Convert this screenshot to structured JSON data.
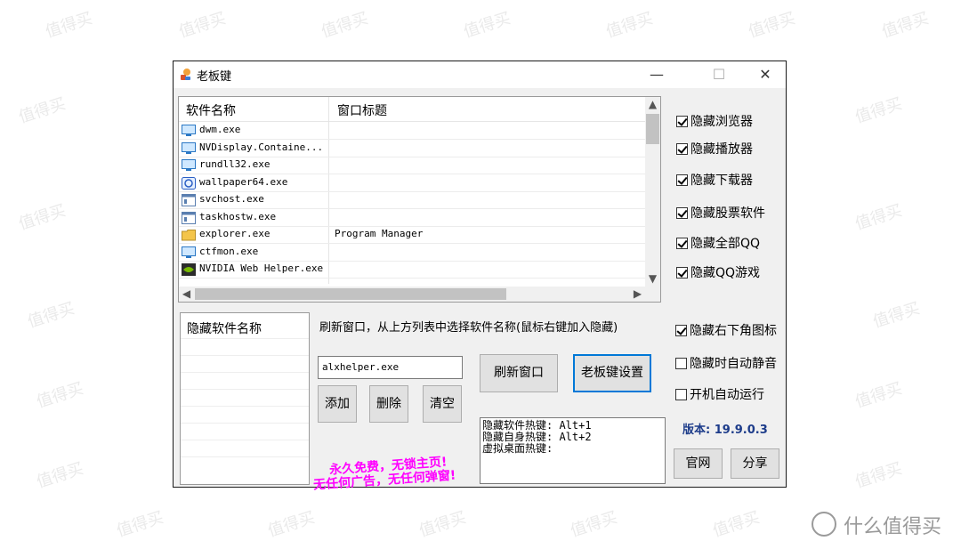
{
  "window": {
    "title": "老板键",
    "min_glyph": "—",
    "max_glyph": "☐",
    "close_glyph": "✕"
  },
  "process_list": {
    "columns": [
      "软件名称",
      "窗口标题"
    ],
    "rows": [
      {
        "name": "dwm.exe",
        "title": "",
        "icon": "monitor-icon"
      },
      {
        "name": "NVDisplay.Containe...",
        "title": "",
        "icon": "monitor-icon"
      },
      {
        "name": "rundll32.exe",
        "title": "",
        "icon": "monitor-icon"
      },
      {
        "name": "wallpaper64.exe",
        "title": "",
        "icon": "wallpaper-app-icon"
      },
      {
        "name": "svchost.exe",
        "title": "",
        "icon": "window-app-icon"
      },
      {
        "name": "taskhostw.exe",
        "title": "",
        "icon": "window-app-icon"
      },
      {
        "name": "explorer.exe",
        "title": "Program Manager",
        "icon": "folder-icon"
      },
      {
        "name": "ctfmon.exe",
        "title": "",
        "icon": "monitor-icon"
      },
      {
        "name": "NVIDIA Web Helper.exe",
        "title": "",
        "icon": "nvidia-icon"
      }
    ]
  },
  "options_top": [
    {
      "label": "隐藏浏览器",
      "checked": true
    },
    {
      "label": "隐藏播放器",
      "checked": true
    },
    {
      "label": "隐藏下载器",
      "checked": true
    },
    {
      "label": "隐藏股票软件",
      "checked": true
    },
    {
      "label": "隐藏全部QQ",
      "checked": true
    },
    {
      "label": "隐藏QQ游戏",
      "checked": true
    }
  ],
  "options_bottom": [
    {
      "label": "隐藏右下角图标",
      "checked": true
    },
    {
      "label": "隐藏时自动静音",
      "checked": false
    },
    {
      "label": "开机自动运行",
      "checked": false
    }
  ],
  "hidden_list": {
    "header": "隐藏软件名称"
  },
  "instructions": "刷新窗口，从上方列表中选择软件名称(鼠标右键加入隐藏)",
  "input": {
    "value": "alxhelper.exe"
  },
  "buttons": {
    "add": "添加",
    "delete": "删除",
    "clear": "清空",
    "refresh": "刷新窗口",
    "settings": "老板键设置",
    "official_site": "官网",
    "share": "分享"
  },
  "hotkeys": {
    "line1": "隐藏软件热键: Alt+1",
    "line2": "隐藏自身热键: Alt+2",
    "line3": "虚拟桌面热键:"
  },
  "promo": {
    "line1": "永久免费，无锁主页!",
    "line2": "无任何广告，无任何弹窗!"
  },
  "version": "版本: 19.9.0.3",
  "watermark": {
    "text": "值得买",
    "brand": "什么值得买"
  }
}
